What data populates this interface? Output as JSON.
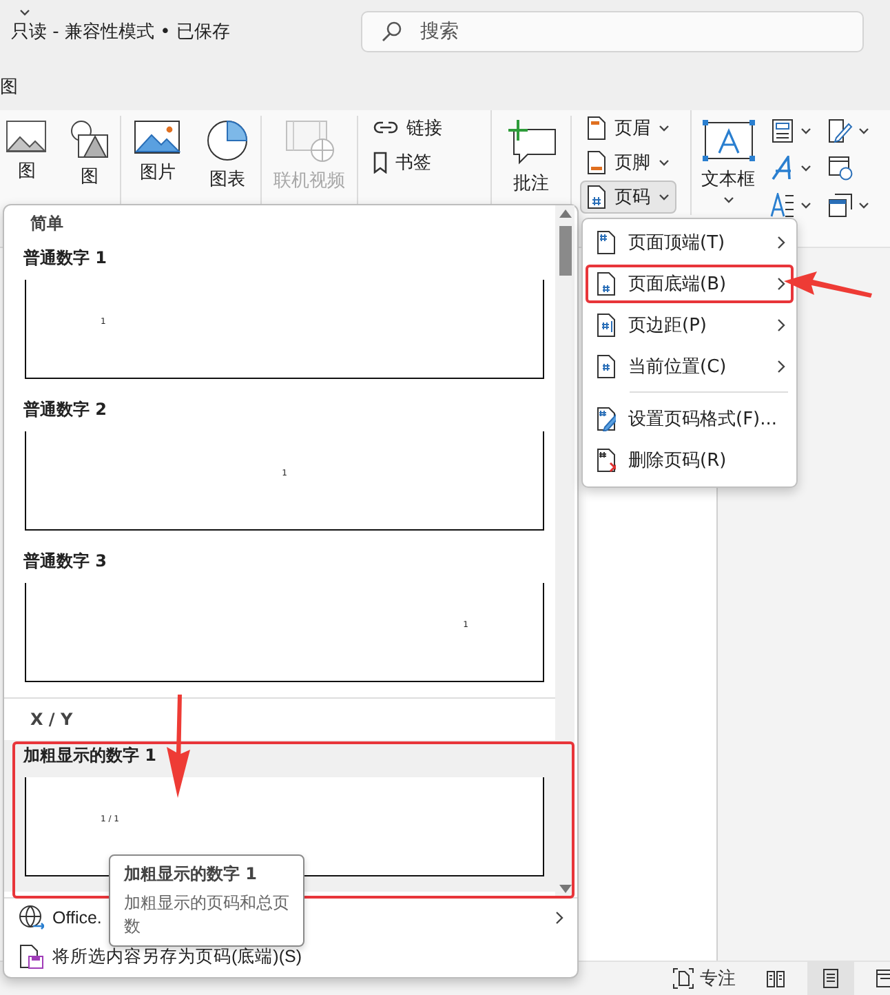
{
  "title_bar": {
    "title": "只读 - 兼容性模式 • 已保存",
    "search": {
      "placeholder": "搜索"
    }
  },
  "tab_strip": {
    "tab": "图"
  },
  "ribbon": {
    "groups": [
      {
        "items": [
          {
            "kind": "narrow",
            "label": "图",
            "disabled": false
          },
          {
            "kind": "narrow",
            "label": "图",
            "disabled": false
          }
        ]
      },
      {
        "items": [
          {
            "kind": "large",
            "label": "图片",
            "disabled": false
          },
          {
            "kind": "large",
            "label": "图表",
            "disabled": false
          }
        ]
      },
      {
        "items": [
          {
            "kind": "large",
            "label": "联机视频",
            "disabled": true
          }
        ]
      },
      {
        "items": [
          {
            "kind": "small",
            "label": "链接",
            "disabled": false
          },
          {
            "kind": "small",
            "label": "书签",
            "disabled": false
          }
        ]
      },
      {
        "items": [
          {
            "kind": "large",
            "label": "批注",
            "disabled": false
          }
        ]
      },
      {
        "items": [
          {
            "kind": "menu",
            "label": "页眉",
            "disabled": false,
            "expanded": false
          },
          {
            "kind": "menu",
            "label": "页脚",
            "disabled": false,
            "expanded": false
          },
          {
            "kind": "menu",
            "label": "页码",
            "disabled": false,
            "expanded": true
          }
        ]
      },
      {
        "items": [
          {
            "kind": "dropdown",
            "label": "文本框",
            "disabled": false
          }
        ]
      }
    ]
  },
  "gallery": {
    "sections": [
      {
        "heading": "简单",
        "items": [
          {
            "kind": "left",
            "title": "普通数字 1",
            "preview": "1",
            "highlighted": false,
            "annotated": false
          },
          {
            "kind": "center",
            "title": "普通数字 2",
            "preview": "1",
            "highlighted": false,
            "annotated": false
          },
          {
            "kind": "right",
            "title": "普通数字 3",
            "preview": "1",
            "highlighted": false,
            "annotated": false
          }
        ]
      },
      {
        "heading": "X / Y",
        "items": [
          {
            "kind": "left",
            "title": "加粗显示的数字 1",
            "preview": "1 / 1",
            "highlighted": true,
            "annotated": true
          }
        ]
      }
    ],
    "footer": [
      {
        "label": "Office.",
        "submenu": true
      },
      {
        "label": "将所选内容另存为页码(底端)(S)",
        "submenu": false
      }
    ]
  },
  "submenu": {
    "items": [
      {
        "kind": "item",
        "label": "页面顶端(T)",
        "submenu": true,
        "annotated": false
      },
      {
        "kind": "item",
        "label": "页面底端(B)",
        "submenu": true,
        "annotated": true
      },
      {
        "kind": "item",
        "label": "页边距(P)",
        "submenu": true,
        "annotated": false
      },
      {
        "kind": "item",
        "label": "当前位置(C)",
        "submenu": true,
        "annotated": false
      },
      {
        "kind": "separator"
      },
      {
        "kind": "item",
        "label": "设置页码格式(F)...",
        "submenu": false,
        "annotated": false
      },
      {
        "kind": "item",
        "label": "删除页码(R)",
        "submenu": false,
        "annotated": false
      }
    ]
  },
  "tooltip": {
    "title": "加粗显示的数字 1",
    "description": "加粗显示的页码和总页数"
  },
  "status_bar": {
    "focus": "专注",
    "views": [
      {
        "selected": false
      },
      {
        "selected": true
      },
      {
        "selected": false
      }
    ]
  }
}
